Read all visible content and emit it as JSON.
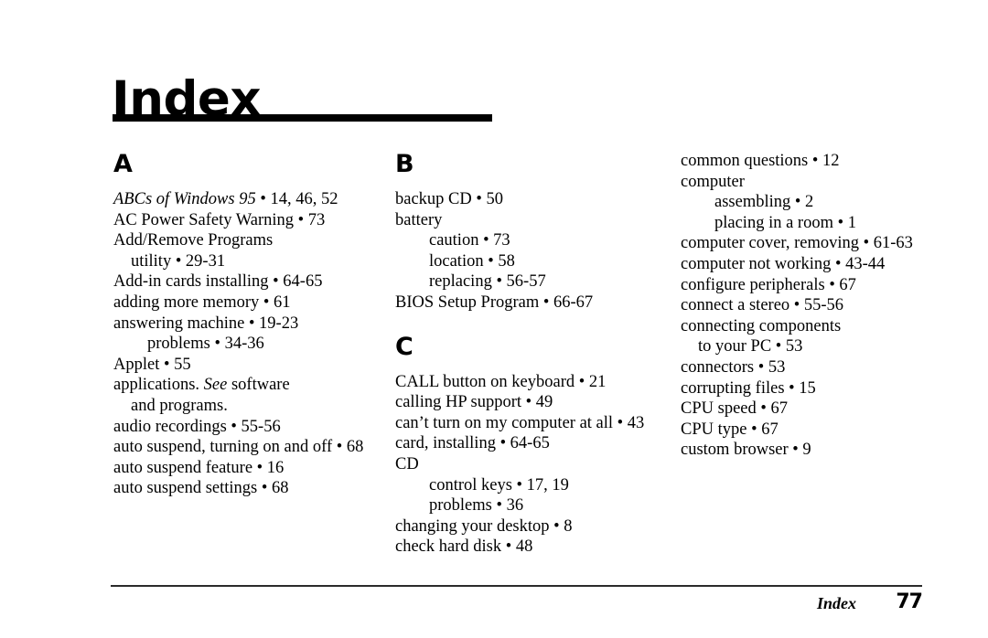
{
  "page": {
    "title": "Index",
    "footer_label": "Index",
    "footer_page_number": "77"
  },
  "columns": [
    {
      "id": "column-1",
      "heading": "A",
      "entries": [
        {
          "level": "main",
          "text": "ABCs of Windows 95 • 14, 46, 52",
          "italic_text": "ABCs of Windows 95",
          "plain_text": " • 14, 46, 52"
        },
        {
          "level": "main",
          "text": "AC Power Safety Warning • 73"
        },
        {
          "level": "main",
          "text": "Add/Remove Programs"
        },
        {
          "level": "cont",
          "text": "utility • 29-31"
        },
        {
          "level": "main",
          "text": "Add-in cards installing • 64-65"
        },
        {
          "level": "main",
          "text": "adding more memory • 61"
        },
        {
          "level": "main",
          "text": "answering machine • 19-23"
        },
        {
          "level": "sub",
          "text": "problems • 34-36"
        },
        {
          "level": "main",
          "text": "Applet • 55"
        },
        {
          "level": "main",
          "text": "applications. See software",
          "pre_text": "applications. ",
          "italic_text": "See",
          "plain_text": " software"
        },
        {
          "level": "cont",
          "text": "and programs."
        },
        {
          "level": "main",
          "text": "audio recordings • 55-56"
        },
        {
          "level": "main",
          "text": "auto suspend, turning on and off • 68"
        },
        {
          "level": "main",
          "text": "auto suspend feature • 16"
        },
        {
          "level": "main",
          "text": "auto suspend settings • 68"
        }
      ]
    },
    {
      "id": "column-2",
      "heading": "B",
      "entries": [
        {
          "level": "main",
          "text": "backup CD • 50"
        },
        {
          "level": "main",
          "text": "battery"
        },
        {
          "level": "sub",
          "text": "caution • 73"
        },
        {
          "level": "sub",
          "text": "location • 58"
        },
        {
          "level": "sub",
          "text": "replacing • 56-57"
        },
        {
          "level": "main",
          "text": "BIOS Setup Program • 66-67"
        }
      ],
      "heading2": "C",
      "entries2": [
        {
          "level": "main",
          "text": "CALL button on keyboard • 21"
        },
        {
          "level": "main",
          "text": "calling HP support • 49"
        },
        {
          "level": "main",
          "text": "can’t turn on my computer at all • 43"
        },
        {
          "level": "main",
          "text": "card, installing • 64-65"
        },
        {
          "level": "main",
          "text": "CD"
        },
        {
          "level": "sub",
          "text": "control keys • 17, 19"
        },
        {
          "level": "sub",
          "text": "problems • 36"
        },
        {
          "level": "main",
          "text": "changing your desktop • 8"
        },
        {
          "level": "main",
          "text": "check hard disk • 48"
        }
      ]
    },
    {
      "id": "column-3",
      "heading": "",
      "entries": [
        {
          "level": "main",
          "text": "common questions • 12"
        },
        {
          "level": "main",
          "text": "computer"
        },
        {
          "level": "sub",
          "text": "assembling • 2"
        },
        {
          "level": "sub",
          "text": "placing in a room • 1"
        },
        {
          "level": "main",
          "text": "computer cover, removing • 61-63"
        },
        {
          "level": "main",
          "text": "computer not working • 43-44"
        },
        {
          "level": "main",
          "text": "configure peripherals • 67"
        },
        {
          "level": "main",
          "text": "connect a stereo • 55-56"
        },
        {
          "level": "main",
          "text": "connecting components"
        },
        {
          "level": "cont",
          "text": "to your PC • 53"
        },
        {
          "level": "main",
          "text": "connectors • 53"
        },
        {
          "level": "main",
          "text": "corrupting files • 15"
        },
        {
          "level": "main",
          "text": "CPU speed • 67"
        },
        {
          "level": "main",
          "text": "CPU type • 67"
        },
        {
          "level": "main",
          "text": "custom browser • 9"
        }
      ]
    }
  ]
}
